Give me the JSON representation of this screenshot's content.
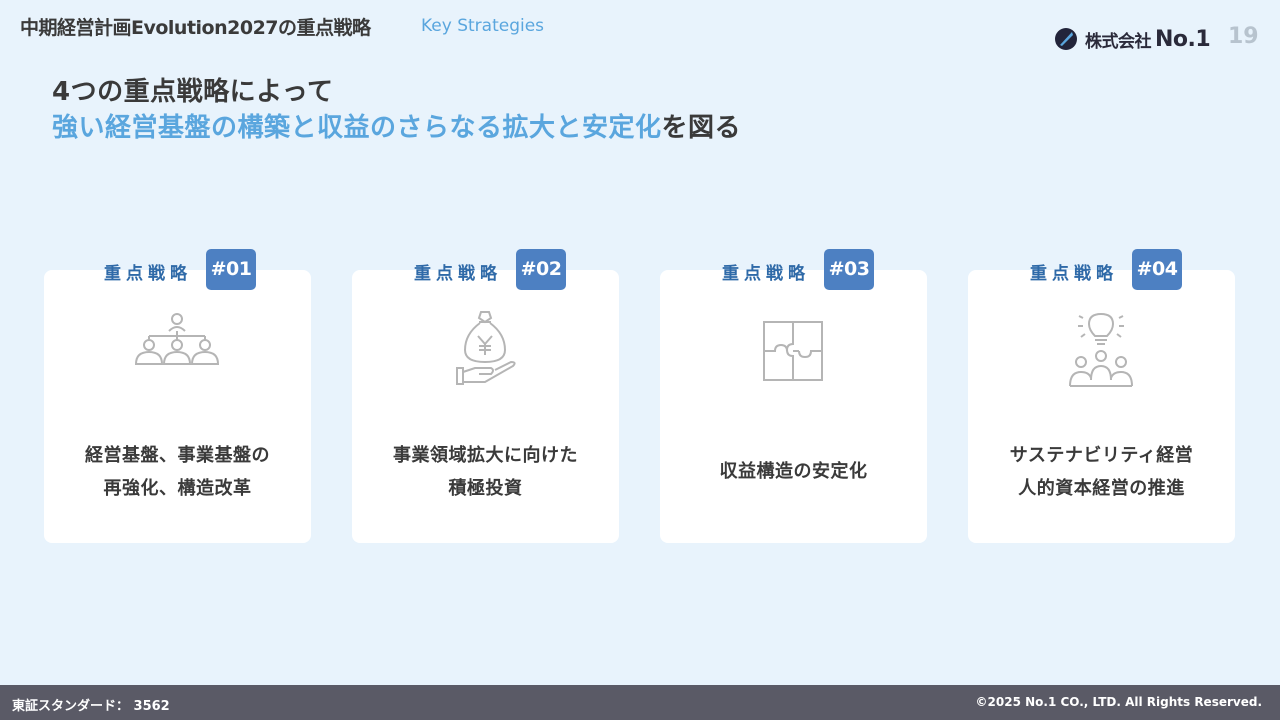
{
  "header": {
    "title": "中期経営計画Evolution2027の重点戦略",
    "subtitle": "Key Strategies",
    "logo_company": "株式会社",
    "logo_number": "No.1",
    "page_number": "19"
  },
  "headline": {
    "line1": "4つの重点戦略によって",
    "line2_accent": "強い経営基盤の構築と収益のさらなる拡大と安定化",
    "line2_rest": "を図る"
  },
  "strategies": [
    {
      "label": "重点戦略",
      "badge": "#01",
      "icon": "org-chart-icon",
      "lines": [
        "経営基盤、事業基盤の",
        "再強化、構造改革"
      ]
    },
    {
      "label": "重点戦略",
      "badge": "#02",
      "icon": "yen-moneybag-hand-icon",
      "lines": [
        "事業領域拡大に向けた",
        "積極投資"
      ]
    },
    {
      "label": "重点戦略",
      "badge": "#03",
      "icon": "puzzle-icon",
      "lines": [
        "収益構造の安定化"
      ]
    },
    {
      "label": "重点戦略",
      "badge": "#04",
      "icon": "lightbulb-people-icon",
      "lines": [
        "サステナビリティ経営",
        "人的資本経営の推進"
      ]
    }
  ],
  "footer": {
    "left": "東証スタンダード： 3562",
    "right": "©2025 No.1 CO., LTD. All Rights Reserved."
  },
  "colors": {
    "background": "#e8f3fc",
    "accent": "#5aa6de",
    "badge": "#4d80c2",
    "label": "#2f6aa8",
    "footer": "#5a5a66"
  }
}
